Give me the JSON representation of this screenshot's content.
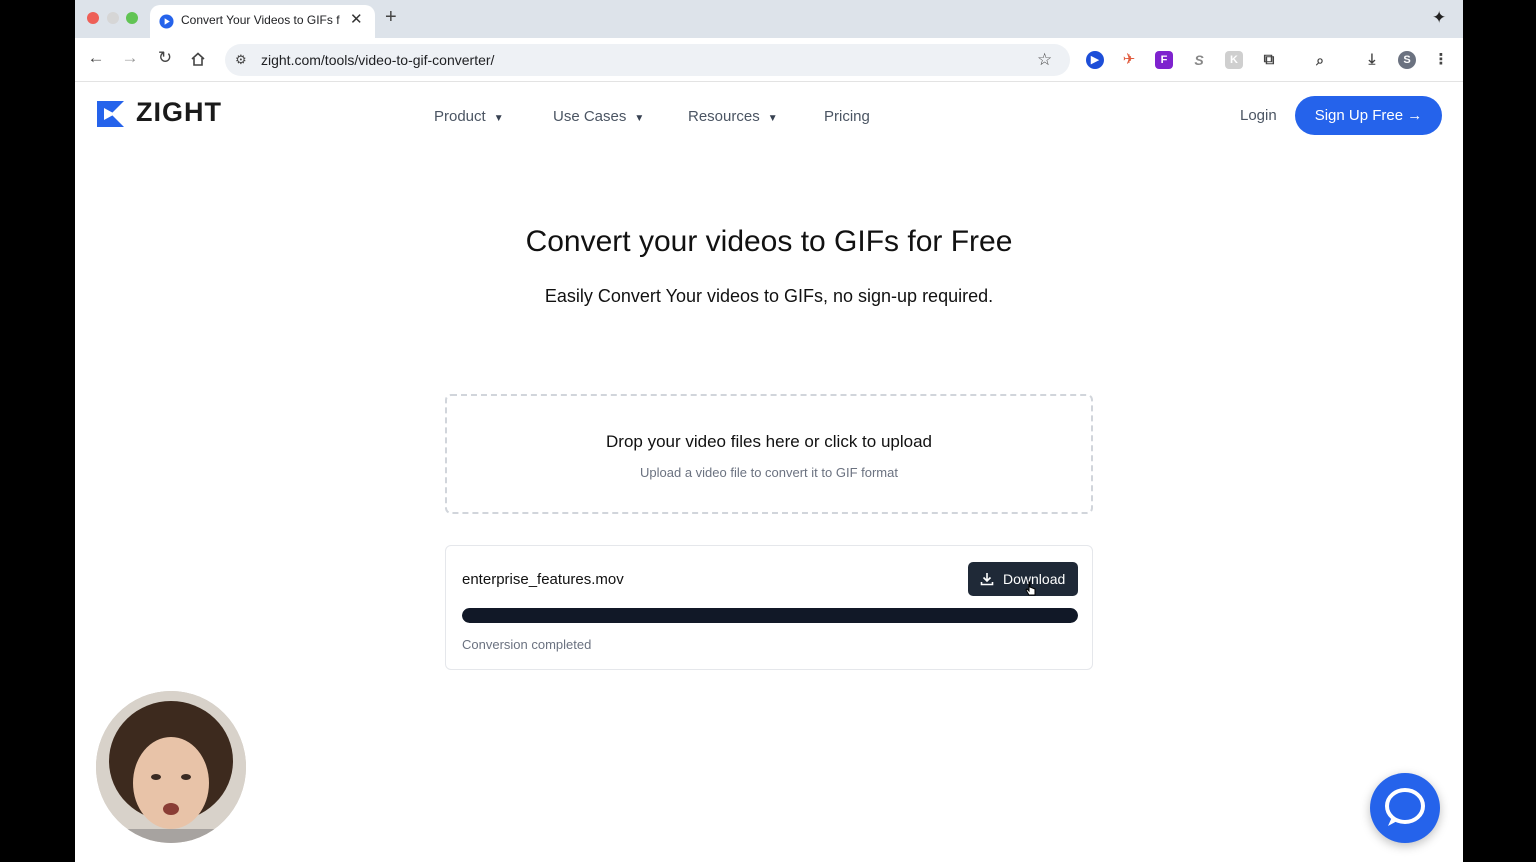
{
  "browser": {
    "tab_title": "Convert Your Videos to GIFs f",
    "url": "zight.com/tools/video-to-gif-converter/",
    "profile_initial": "S"
  },
  "site": {
    "brand": "ZIGHT",
    "nav": [
      {
        "label": "Product"
      },
      {
        "label": "Use Cases"
      },
      {
        "label": "Resources"
      },
      {
        "label": "Pricing"
      }
    ],
    "login_label": "Login",
    "signup_label": "Sign Up Free →"
  },
  "hero": {
    "title": "Convert your videos to GIFs for Free",
    "subtitle": "Easily Convert Your videos to GIFs, no sign-up required."
  },
  "dropzone": {
    "title": "Drop your video files here or click to upload",
    "subtitle": "Upload a video file to convert it to GIF format"
  },
  "file": {
    "name": "enterprise_features.mov",
    "download_label": "Download",
    "progress_percent": 100,
    "status": "Conversion completed"
  },
  "colors": {
    "accent": "#2563eb",
    "dark_button": "#1f2937"
  }
}
